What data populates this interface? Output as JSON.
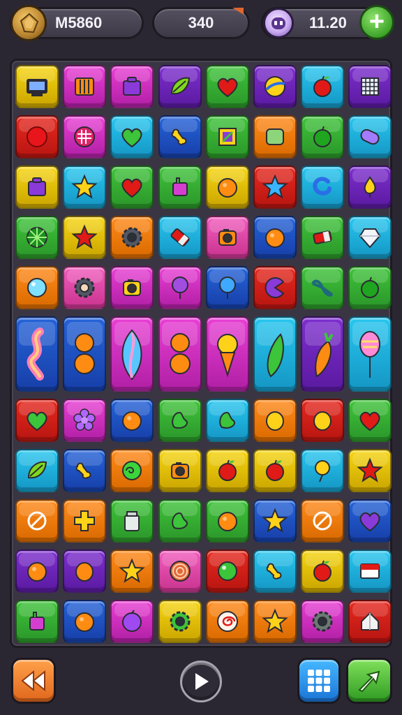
{
  "hud": {
    "player_name": "M5860",
    "score": "340",
    "currency": "11.20",
    "icons": {
      "coin": "gold-badge-icon",
      "gem": "purple-face-gem-icon",
      "plus": "plus-icon"
    }
  },
  "colors": {
    "background": "#2b2732",
    "board": "#3a3542",
    "yellow": "#f6d512",
    "magenta": "#e83fd4",
    "purple": "#7d2fce",
    "green": "#3fc33a",
    "cyan": "#27c6ef",
    "red": "#e5291f",
    "blue": "#2563d8",
    "orange": "#ff8a1a",
    "pink": "#f25bbd"
  },
  "board": {
    "rows": 11,
    "cols": 8,
    "tiles": [
      [
        {
          "c": "yellow",
          "i": "monitor"
        },
        {
          "c": "magenta",
          "i": "crate"
        },
        {
          "c": "magenta",
          "i": "box"
        },
        {
          "c": "purple",
          "i": "leaf"
        },
        {
          "c": "green",
          "i": "heart"
        },
        {
          "c": "purple",
          "i": "ball"
        },
        {
          "c": "cyan",
          "i": "apple"
        },
        {
          "c": "purple",
          "i": "grid"
        }
      ],
      [
        {
          "c": "red",
          "i": "circle"
        },
        {
          "c": "magenta",
          "i": "swirl"
        },
        {
          "c": "cyan",
          "i": "heart"
        },
        {
          "c": "blue",
          "i": "bone"
        },
        {
          "c": "green",
          "i": "frame"
        },
        {
          "c": "orange",
          "i": "square"
        },
        {
          "c": "green",
          "i": "apple"
        },
        {
          "c": "cyan",
          "i": "pill"
        }
      ],
      [
        {
          "c": "yellow",
          "i": "box"
        },
        {
          "c": "cyan",
          "i": "star"
        },
        {
          "c": "green",
          "i": "heart"
        },
        {
          "c": "green",
          "i": "bag"
        },
        {
          "c": "yellow",
          "i": "orange"
        },
        {
          "c": "red",
          "i": "star"
        },
        {
          "c": "cyan",
          "i": "hook"
        },
        {
          "c": "purple",
          "i": "drop"
        }
      ],
      [
        {
          "c": "green",
          "i": "wheel"
        },
        {
          "c": "yellow",
          "i": "star"
        },
        {
          "c": "orange",
          "i": "gear"
        },
        {
          "c": "cyan",
          "i": "eraser"
        },
        {
          "c": "pink",
          "i": "camera"
        },
        {
          "c": "blue",
          "i": "orange"
        },
        {
          "c": "green",
          "i": "eraser"
        },
        {
          "c": "cyan",
          "i": "gem"
        }
      ],
      [
        {
          "c": "orange",
          "i": "bubble"
        },
        {
          "c": "pink",
          "i": "gear"
        },
        {
          "c": "magenta",
          "i": "camera"
        },
        {
          "c": "magenta",
          "i": "balloon"
        },
        {
          "c": "blue",
          "i": "balloon"
        },
        {
          "c": "red",
          "i": "pacman"
        },
        {
          "c": "green",
          "i": "bow"
        },
        {
          "c": "green",
          "i": "apple"
        }
      ],
      [
        {
          "c": "blue",
          "i": "swirl-tall",
          "tall": true
        },
        {
          "c": "blue",
          "i": "gourd",
          "tall": true
        },
        {
          "c": "magenta",
          "i": "leaf-tall",
          "tall": true
        },
        {
          "c": "magenta",
          "i": "gourd",
          "tall": true
        },
        {
          "c": "magenta",
          "i": "icecream",
          "tall": true
        },
        {
          "c": "cyan",
          "i": "bean",
          "tall": true
        },
        {
          "c": "purple",
          "i": "carrot",
          "tall": true
        },
        {
          "c": "cyan",
          "i": "cone",
          "tall": true
        }
      ],
      [
        {
          "c": "red",
          "i": "heart"
        },
        {
          "c": "magenta",
          "i": "flower"
        },
        {
          "c": "blue",
          "i": "orange"
        },
        {
          "c": "green",
          "i": "bean"
        },
        {
          "c": "cyan",
          "i": "bean"
        },
        {
          "c": "orange",
          "i": "lemon"
        },
        {
          "c": "red",
          "i": "lemon"
        },
        {
          "c": "green",
          "i": "heart"
        }
      ],
      [
        {
          "c": "cyan",
          "i": "leaf"
        },
        {
          "c": "blue",
          "i": "bone"
        },
        {
          "c": "orange",
          "i": "coil"
        },
        {
          "c": "yellow",
          "i": "camera"
        },
        {
          "c": "yellow",
          "i": "apple"
        },
        {
          "c": "yellow",
          "i": "apple"
        },
        {
          "c": "cyan",
          "i": "lollipop"
        },
        {
          "c": "yellow",
          "i": "star"
        }
      ],
      [
        {
          "c": "orange",
          "i": "forbidden"
        },
        {
          "c": "orange",
          "i": "cross"
        },
        {
          "c": "green",
          "i": "jar"
        },
        {
          "c": "green",
          "i": "bean"
        },
        {
          "c": "green",
          "i": "orange"
        },
        {
          "c": "blue",
          "i": "star"
        },
        {
          "c": "orange",
          "i": "forbidden"
        },
        {
          "c": "blue",
          "i": "heart"
        }
      ],
      [
        {
          "c": "purple",
          "i": "orange"
        },
        {
          "c": "purple",
          "i": "lemon"
        },
        {
          "c": "orange",
          "i": "star"
        },
        {
          "c": "pink",
          "i": "target"
        },
        {
          "c": "red",
          "i": "bubble"
        },
        {
          "c": "cyan",
          "i": "bone"
        },
        {
          "c": "yellow",
          "i": "apple"
        },
        {
          "c": "cyan",
          "i": "card"
        }
      ],
      [
        {
          "c": "green",
          "i": "bag"
        },
        {
          "c": "blue",
          "i": "orange"
        },
        {
          "c": "magenta",
          "i": "plum"
        },
        {
          "c": "yellow",
          "i": "gear"
        },
        {
          "c": "orange",
          "i": "spiral"
        },
        {
          "c": "orange",
          "i": "star"
        },
        {
          "c": "magenta",
          "i": "gear"
        },
        {
          "c": "red",
          "i": "house"
        }
      ]
    ]
  },
  "controls": {
    "back": "rewind-icon",
    "play": "play-icon",
    "grid": "grid-icon",
    "next": "arrow-icon"
  }
}
